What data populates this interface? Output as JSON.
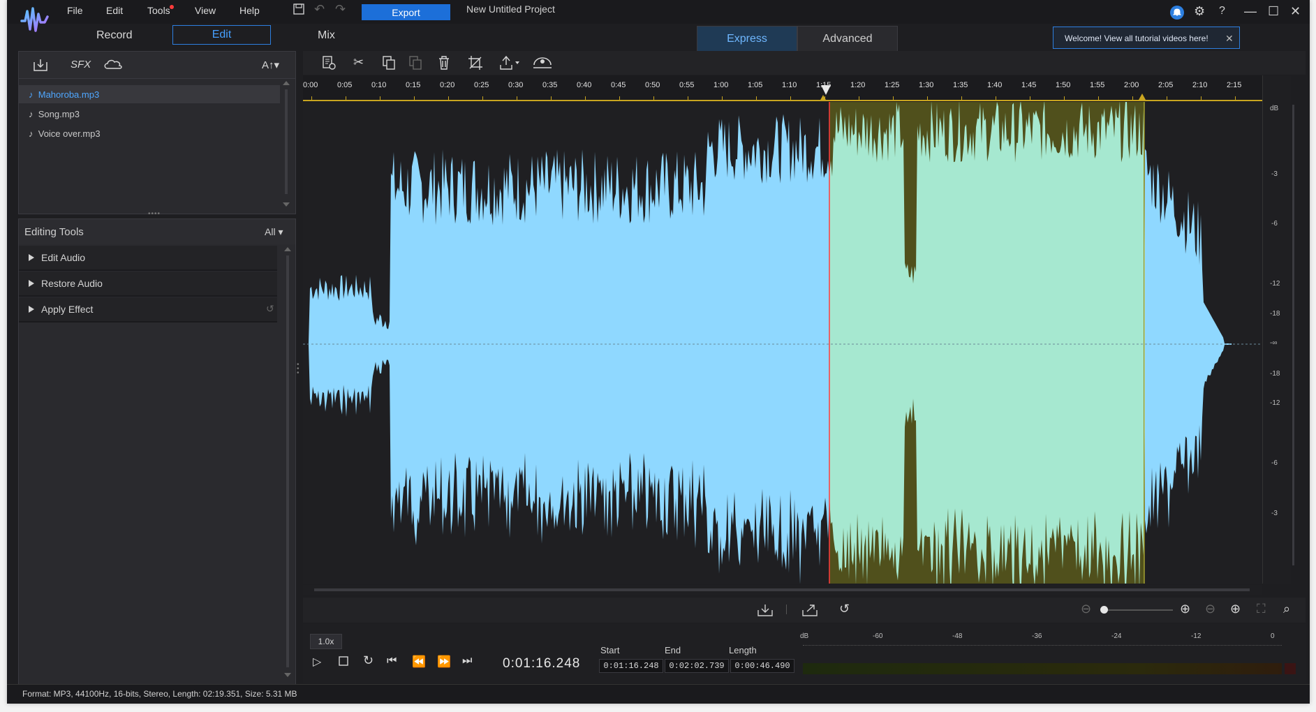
{
  "menu": {
    "file": "File",
    "edit": "Edit",
    "tools": "Tools",
    "view": "View",
    "help": "Help"
  },
  "toolbar": {
    "export_label": "Export",
    "project_title": "New Untitled Project"
  },
  "modes": {
    "record": "Record",
    "edit": "Edit",
    "mix": "Mix"
  },
  "view_tabs": {
    "express": "Express",
    "advanced": "Advanced"
  },
  "welcome": {
    "text": "Welcome! View all tutorial videos here!"
  },
  "library": {
    "sfx": "SFX",
    "text_btn": "A↑▾",
    "files": [
      {
        "name": "Mahoroba.mp3"
      },
      {
        "name": "Song.mp3"
      },
      {
        "name": "Voice over.mp3"
      }
    ]
  },
  "editing_tools": {
    "title": "Editing Tools",
    "filter": "All ▾",
    "items": [
      {
        "label": "Edit Audio"
      },
      {
        "label": "Restore Audio"
      },
      {
        "label": "Apply Effect"
      }
    ]
  },
  "timeline": {
    "ticks": [
      "0:00",
      "0:05",
      "0:10",
      "0:15",
      "0:20",
      "0:25",
      "0:30",
      "0:35",
      "0:40",
      "0:45",
      "0:50",
      "0:55",
      "1:00",
      "1:05",
      "1:10",
      "1:15",
      "1:20",
      "1:25",
      "1:30",
      "1:35",
      "1:40",
      "1:45",
      "1:50",
      "1:55",
      "2:00",
      "2:05",
      "2:10",
      "2:15"
    ]
  },
  "db_scale": {
    "top": "dB",
    "labels": [
      "-3",
      "-6",
      "-12",
      "-18",
      "-∞",
      "-18",
      "-12",
      "-6",
      "-3"
    ]
  },
  "transport": {
    "speed": "1.0x",
    "current_time": "0:01:16.248"
  },
  "selection": {
    "start_label": "Start",
    "end_label": "End",
    "length_label": "Length",
    "start": "0:01:16.248",
    "end": "0:02:02.739",
    "length": "0:00:46.490"
  },
  "meter": {
    "labels": [
      "dB",
      "-60",
      "-48",
      "-36",
      "-24",
      "-12",
      "0"
    ]
  },
  "status": {
    "text": "Format: MP3, 44100Hz, 16-bits, Stereo, Length: 02:19.351, Size: 5.31 MB"
  },
  "colors": {
    "accent": "#2d7fe0",
    "wave": "#8fd8ff",
    "wave_selected": "#a6e8d0",
    "selection_bg": "#52521f",
    "playhead": "#ff3b3b"
  }
}
